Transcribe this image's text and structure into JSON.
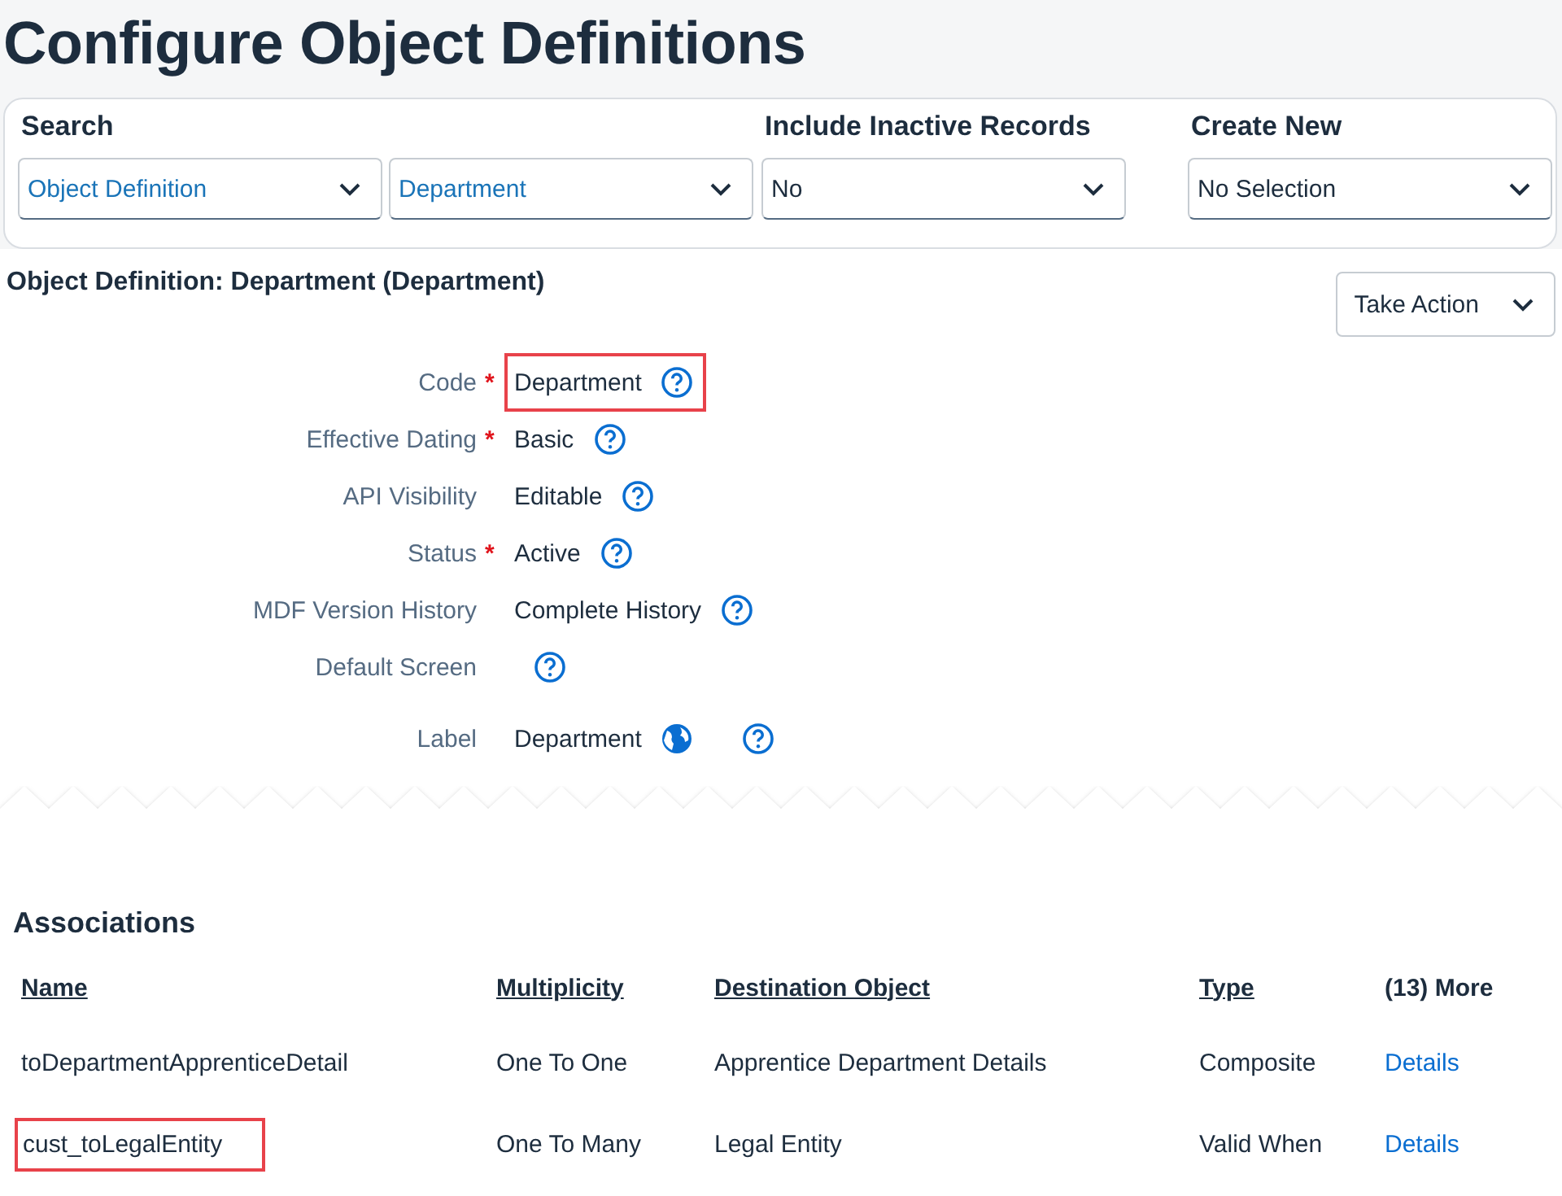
{
  "page_title": "Configure Object Definitions",
  "search_panel": {
    "groups": [
      {
        "heading": "Search",
        "selects": [
          {
            "value": "Object Definition",
            "accent": true
          },
          {
            "value": "Department",
            "accent": true
          }
        ]
      },
      {
        "heading": "Include Inactive Records",
        "selects": [
          {
            "value": "No",
            "accent": false
          }
        ]
      },
      {
        "heading": "Create New",
        "selects": [
          {
            "value": "No Selection",
            "accent": false
          }
        ]
      }
    ]
  },
  "definition": {
    "title": "Object Definition: Department (Department)",
    "action_button": "Take Action",
    "fields": [
      {
        "label": "Code",
        "required_mark": "*",
        "value": "Department",
        "translatable": false,
        "highlighted": true
      },
      {
        "label": "Effective Dating",
        "required_mark": "*",
        "value": "Basic",
        "translatable": false,
        "highlighted": false
      },
      {
        "label": "API Visibility",
        "value": "Editable",
        "translatable": false,
        "highlighted": false
      },
      {
        "label": "Status",
        "required_mark": "*",
        "value": "Active",
        "translatable": false,
        "highlighted": false
      },
      {
        "label": "MDF Version History",
        "value": "Complete History",
        "translatable": false,
        "highlighted": false
      },
      {
        "label": "Default Screen",
        "translatable": false,
        "highlighted": false
      },
      {
        "label": "Label",
        "value": "Department",
        "translatable": true,
        "highlighted": false
      }
    ]
  },
  "associations": {
    "title": "Associations",
    "columns": [
      {
        "label": "Name",
        "sortable": true
      },
      {
        "label": "Multiplicity",
        "sortable": true
      },
      {
        "label": "Destination Object",
        "sortable": true
      },
      {
        "label": "Type",
        "sortable": true
      },
      {
        "label": "(13) More",
        "sortable": false
      }
    ],
    "rows": [
      {
        "name": "toDepartmentApprenticeDetail",
        "multiplicity": "One To One",
        "destination": "Apprentice Department Details",
        "type": "Composite",
        "link": "Details",
        "highlighted": false
      },
      {
        "name": "cust_toLegalEntity",
        "multiplicity": "One To Many",
        "destination": "Legal Entity",
        "type": "Valid When",
        "link": "Details",
        "highlighted": true
      }
    ]
  }
}
